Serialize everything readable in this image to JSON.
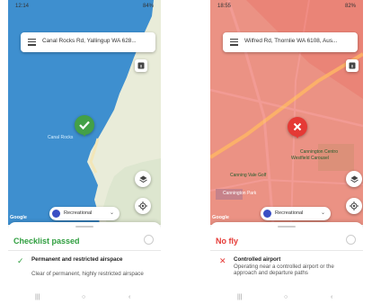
{
  "left": {
    "status_time": "12:14",
    "status_icons": "84%",
    "address": "Canal Rocks Rd, Yallingup WA 628...",
    "place_label": "Canal Rocks",
    "google": "Google",
    "mode_label": "Recreational",
    "result_title": "Checklist passed",
    "result_color": "#2e9e3e",
    "rule_title": "Permanent and restricted airspace",
    "rule_desc": "Clear of permanent, highly restricted airspace"
  },
  "right": {
    "status_time": "18:55",
    "status_icons": "82%",
    "address": "Wilfred Rd, Thornlie WA 6108, Aus...",
    "poi_1": "Cannington Centro",
    "poi_2": "Westfield Carousel",
    "poi_3": "Canning Vale Golf",
    "poi_4": "Cannington Park",
    "google": "Google",
    "mode_label": "Recreational",
    "result_title": "No fly",
    "result_color": "#e53935",
    "rule_title": "Controlled airport",
    "rule_desc": "Operating near a controlled airport or the approach and departure paths"
  },
  "nav": {
    "recents": "|||",
    "home": "○",
    "back": "‹"
  }
}
